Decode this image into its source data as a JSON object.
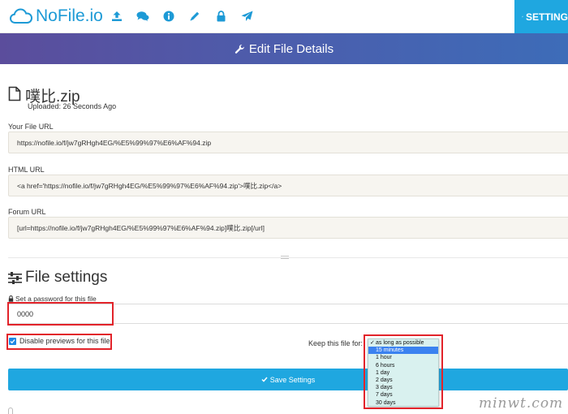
{
  "brand": {
    "name": "NoFile.io"
  },
  "nav": {
    "icons": [
      "upload-icon",
      "chat-icon",
      "info-icon",
      "pencil-icon",
      "lock-icon",
      "paper-plane-icon"
    ],
    "settings_label": "SETTING"
  },
  "banner": {
    "title": "Edit File Details"
  },
  "file": {
    "name": "噗比.zip",
    "uploaded": "Uploaded: 26 Seconds Ago"
  },
  "links": {
    "file_url_label": "Your File URL",
    "file_url": "https://nofile.io/f/jw7gRHgh4EG/%E5%99%97%E6%AF%94.zip",
    "html_url_label": "HTML URL",
    "html_url": "<a href='https://nofile.io/f/jw7gRHgh4EG/%E5%99%97%E6%AF%94.zip'>噗比.zip</a>",
    "forum_url_label": "Forum URL",
    "forum_url": "[url=https://nofile.io/f/jw7gRHgh4EG/%E5%99%97%E6%AF%94.zip]噗比.zip[/url]"
  },
  "settings": {
    "title": "File settings",
    "password_label": "Set a password for this file",
    "password_value": "0000",
    "disable_previews_label": "Disable previews for this file",
    "disable_previews_checked": true,
    "keep_label": "Keep this file for:",
    "keep_options": [
      "as long as possible",
      "15 minutes",
      "1 hour",
      "6 hours",
      "1 day",
      "2 days",
      "3 days",
      "7 days",
      "30 days"
    ],
    "keep_checked": "as long as possible",
    "keep_highlighted": "15 minutes",
    "save_label": "Save Settings"
  },
  "watermark": "minwt.com",
  "colors": {
    "accent": "#1fa7e0",
    "brand": "#1d9ad6",
    "banner_start": "#5b4d9c",
    "banner_end": "#3d6cb8",
    "highlight": "#e2232a"
  }
}
